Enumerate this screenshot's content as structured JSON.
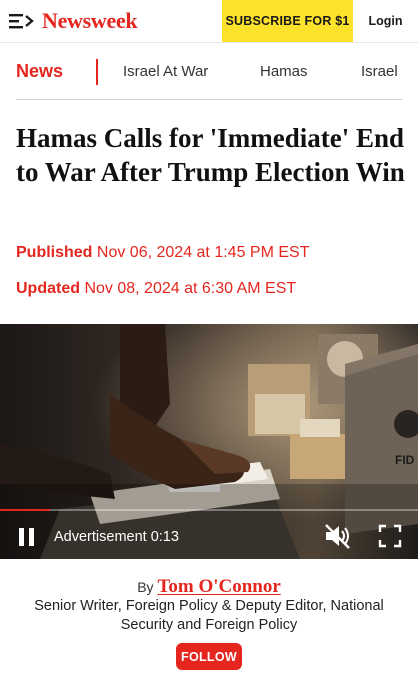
{
  "header": {
    "logo_text": "Newsweek",
    "subscribe_label": "SUBSCRIBE FOR $1",
    "login_label": "Login",
    "menu_icon": "menu-icon"
  },
  "section_nav": {
    "current_section": "News",
    "links": [
      "Israel At War",
      "Hamas",
      "Israel"
    ]
  },
  "article": {
    "headline": "Hamas Calls for 'Immediate' End to War After Trump Election Win",
    "published_label": "Published",
    "published_date": "Nov 06, 2024 at 1:45 PM EST",
    "updated_label": "Updated",
    "updated_date": "Nov 08, 2024 at 6:30 AM EST"
  },
  "video": {
    "status_text": "Advertisement 0:13",
    "progress": 0.12,
    "controls": [
      "pause-icon",
      "muted-speaker-icon",
      "fullscreen-icon"
    ]
  },
  "byline": {
    "by_label": "By",
    "author_name": "Tom O'Connor",
    "author_title": "Senior Writer, Foreign Policy & Deputy Editor, National Security and Foreign Policy",
    "follow_label": "FOLLOW"
  },
  "colors": {
    "brand_red": "#e4261f",
    "subscribe_yellow": "#fce22a"
  }
}
